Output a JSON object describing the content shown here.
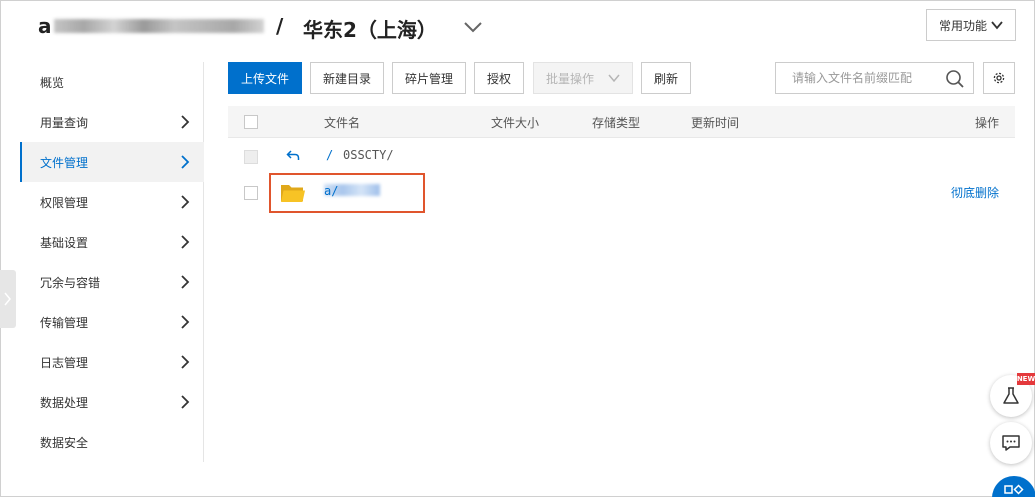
{
  "header": {
    "bucket_prefix": "a",
    "separator": "/",
    "region": "华东2（上海）",
    "common_functions": "常用功能"
  },
  "sidebar": {
    "items": [
      {
        "label": "概览"
      },
      {
        "label": "用量查询"
      },
      {
        "label": "文件管理"
      },
      {
        "label": "权限管理"
      },
      {
        "label": "基础设置"
      },
      {
        "label": "冗余与容错"
      },
      {
        "label": "传输管理"
      },
      {
        "label": "日志管理"
      },
      {
        "label": "数据处理"
      },
      {
        "label": "数据安全"
      }
    ]
  },
  "toolbar": {
    "upload": "上传文件",
    "new_folder": "新建目录",
    "fragments": "碎片管理",
    "authorize": "授权",
    "batch": "批量操作",
    "refresh": "刷新",
    "search_placeholder": "请输入文件名前缀匹配"
  },
  "table": {
    "headers": {
      "name": "文件名",
      "size": "文件大小",
      "storage": "存储类型",
      "updated": "更新时间",
      "actions": "操作"
    },
    "breadcrumb_root": "/",
    "breadcrumb_path": "0SSCTY/",
    "folder_prefix": "u",
    "folder_suffix": "a/",
    "delete_action": "彻底删除"
  },
  "floating": {
    "new_badge": "NEW"
  },
  "colors": {
    "primary": "#0070cc",
    "highlight": "#e0552d",
    "folder": "#f7c325"
  }
}
